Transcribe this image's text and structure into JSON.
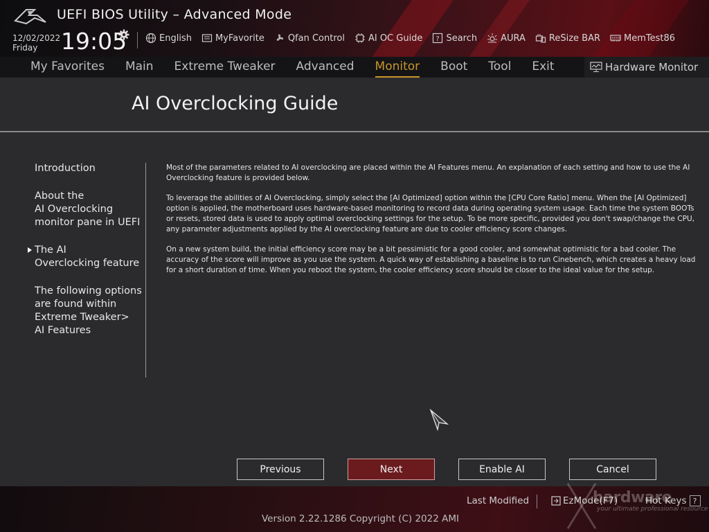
{
  "header": {
    "title": "UEFI BIOS Utility – Advanced Mode",
    "date": "12/02/2022",
    "day": "Friday",
    "time": "19:05",
    "toolbar": [
      {
        "label": "English",
        "icon": "globe-icon"
      },
      {
        "label": "MyFavorite",
        "icon": "favorite-icon"
      },
      {
        "label": "Qfan Control",
        "icon": "fan-icon"
      },
      {
        "label": "AI OC Guide",
        "icon": "chip-icon"
      },
      {
        "label": "Search",
        "icon": "help-search-icon"
      },
      {
        "label": "AURA",
        "icon": "aura-light-icon"
      },
      {
        "label": "ReSize BAR",
        "icon": "resize-bar-icon"
      },
      {
        "label": "MemTest86",
        "icon": "memory-icon"
      }
    ]
  },
  "nav": {
    "tabs": [
      "My Favorites",
      "Main",
      "Extreme Tweaker",
      "Advanced",
      "Monitor",
      "Boot",
      "Tool",
      "Exit"
    ],
    "active": "Monitor",
    "hardware_monitor": "Hardware Monitor"
  },
  "page": {
    "title": "AI Overclocking Guide",
    "side_items": [
      "Introduction",
      "About the\nAI Overclocking\nmonitor pane in UEFI",
      "The AI\nOverclocking feature",
      "The following options\nare found within\nExtreme Tweaker>\nAI Features"
    ],
    "current_side_index": 2,
    "paragraphs": [
      "Most of the parameters related to AI overclocking are placed within the AI Features menu. An explanation of each setting and how to use the AI Overclocking feature is provided below.",
      "To leverage the abilities of AI Overclocking, simply select the [AI Optimized] option within the [CPU Core Ratio] menu. When the [AI Optimized] option is applied, the motherboard uses hardware-based monitoring to record data during operating system usage. Each time the system BOOTs or resets, stored data is used to apply optimal overclocking settings for the setup. To be more specific, provided you don't swap/change the CPU, any parameter adjustments applied by the AI overclocking feature are due to cooler efficiency score changes.",
      "On a new system build, the initial efficiency score may be a bit pessimistic for a good cooler, and somewhat optimistic for a bad cooler. The accuracy of the score will improve as you use the system. A quick way of establishing a baseline is to run Cinebench, which creates a heavy load for a short duration of time. When you reboot the system, the cooler efficiency score should be closer to the ideal value for the setup."
    ],
    "buttons": {
      "previous": "Previous",
      "next": "Next",
      "enable_ai": "Enable AI",
      "cancel": "Cancel"
    }
  },
  "footer": {
    "last_modified": "Last Modified",
    "ez_mode": "EzMode(F7)",
    "hot_keys": "Hot Keys",
    "hot_keys_key": "?",
    "version": "Version 2.22.1286 Copyright (C) 2022 AMI"
  },
  "watermark": {
    "text": "hardware",
    "subtext": "your ultimate professional resource"
  },
  "colors": {
    "accent": "#c8962a",
    "primary_button": "#6b1b1e",
    "background": "#2b2b2d",
    "header_red": "#5a1016"
  }
}
